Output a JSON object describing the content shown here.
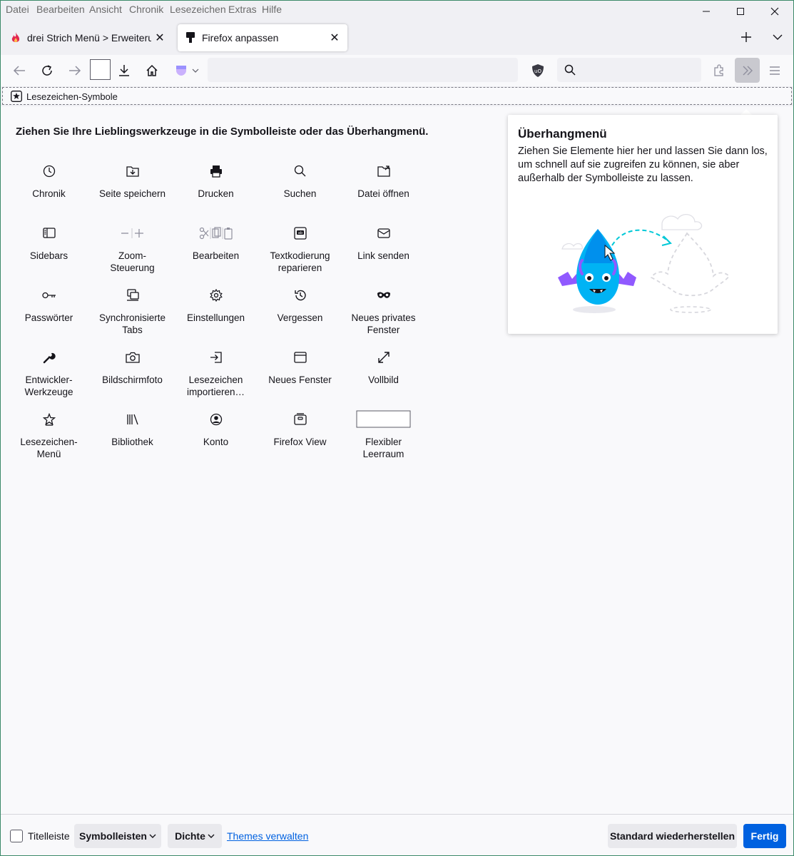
{
  "menubar": {
    "items": [
      "Datei",
      "Bearbeiten",
      "Ansicht",
      "Chronik",
      "Lesezeichen",
      "Extras",
      "Hilfe"
    ]
  },
  "tabs": [
    {
      "label": "drei Strich Menü > Erweiterungen",
      "favicon": "flame-icon",
      "active": false
    },
    {
      "label": "Firefox anpassen",
      "favicon": "paintbrush-icon",
      "active": true
    }
  ],
  "bookmarks_toolbar": {
    "label": "Lesezeichen-Symbole"
  },
  "heading": "Ziehen Sie Ihre Lieblingswerkzeuge in die Symbolleiste oder das Überhangmenü.",
  "palette": [
    {
      "label": "Chronik",
      "icon": "clock-icon"
    },
    {
      "label": "Seite speichern",
      "icon": "save-page-icon"
    },
    {
      "label": "Drucken",
      "icon": "printer-icon"
    },
    {
      "label": "Suchen",
      "icon": "search-icon"
    },
    {
      "label": "Datei öffnen",
      "icon": "open-file-icon"
    },
    {
      "label": "Sidebars",
      "icon": "sidebar-icon"
    },
    {
      "label": "Zoom-\nSteuerung",
      "icon": "zoom-icon"
    },
    {
      "label": "Bearbeiten",
      "icon": "edit-icon"
    },
    {
      "label": "Textkodierung\nreparieren",
      "icon": "text-encoding-icon"
    },
    {
      "label": "Link senden",
      "icon": "mail-icon"
    },
    {
      "label": "Passwörter",
      "icon": "key-icon"
    },
    {
      "label": "Synchronisierte\nTabs",
      "icon": "synced-tabs-icon"
    },
    {
      "label": "Einstellungen",
      "icon": "gear-icon"
    },
    {
      "label": "Vergessen",
      "icon": "forget-icon"
    },
    {
      "label": "Neues privates\nFenster",
      "icon": "private-mask-icon"
    },
    {
      "label": "Entwickler-\nWerkzeuge",
      "icon": "wrench-icon"
    },
    {
      "label": "Bildschirmfoto",
      "icon": "camera-icon"
    },
    {
      "label": "Lesezeichen\nimportieren…",
      "icon": "import-icon"
    },
    {
      "label": "Neues Fenster",
      "icon": "window-icon"
    },
    {
      "label": "Vollbild",
      "icon": "fullscreen-icon"
    },
    {
      "label": "Lesezeichen-\nMenü",
      "icon": "bookmark-star-icon"
    },
    {
      "label": "Bibliothek",
      "icon": "library-icon"
    },
    {
      "label": "Konto",
      "icon": "account-icon"
    },
    {
      "label": "Firefox View",
      "icon": "firefox-view-icon"
    },
    {
      "label": "Flexibler\nLeerraum",
      "icon": "flexible-space-icon"
    }
  ],
  "overflow": {
    "title": "Überhangmenü",
    "description": "Ziehen Sie Elemente hier her und lassen Sie dann los, um schnell auf sie zugreifen zu können, sie aber außerhalb der Symbolleiste zu lassen."
  },
  "footer": {
    "titlebar_label": "Titelleiste",
    "toolbars_label": "Symbolleisten",
    "density_label": "Dichte",
    "themes_link": "Themes verwalten",
    "restore_label": "Standard wiederherstellen",
    "done_label": "Fertig"
  },
  "colors": {
    "accent": "#0061e0",
    "content_bg": "#f9f9fb",
    "chrome_bg": "#f0f0f4"
  }
}
